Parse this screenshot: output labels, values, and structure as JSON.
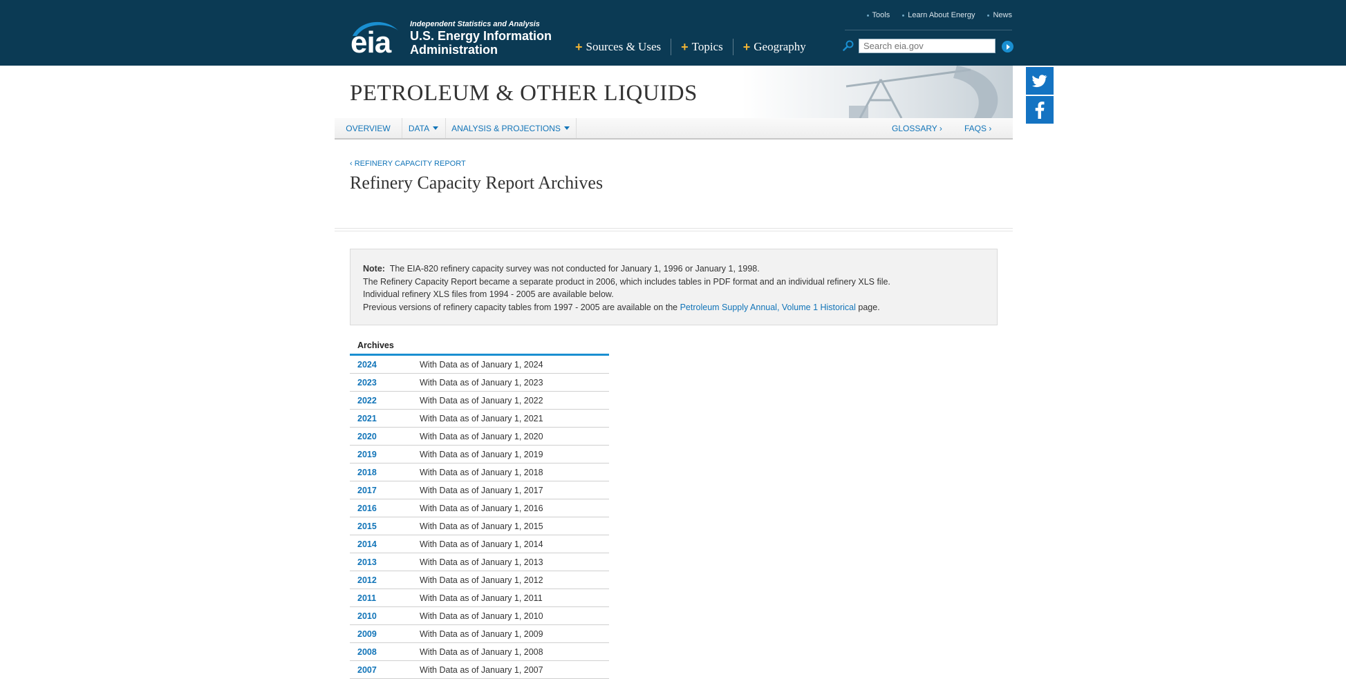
{
  "header": {
    "logo_text": "eia",
    "tagline": "Independent Statistics and Analysis",
    "agency_name": "U.S. Energy Information Administration",
    "main_nav": [
      {
        "label": "Sources & Uses"
      },
      {
        "label": "Topics"
      },
      {
        "label": "Geography"
      }
    ],
    "util_nav": [
      {
        "label": "Tools"
      },
      {
        "label": "Learn About Energy"
      },
      {
        "label": "News"
      }
    ],
    "search": {
      "placeholder": "Search eia.gov",
      "value": ""
    },
    "colors": {
      "bar": "#0b3a54",
      "accent": "#f1b434",
      "link": "#1174b8"
    }
  },
  "social": {
    "icons": [
      "twitter-icon",
      "facebook-icon"
    ]
  },
  "banner": {
    "title": "PETROLEUM & OTHER LIQUIDS"
  },
  "subnav": {
    "items": [
      {
        "label": "OVERVIEW"
      },
      {
        "label": "DATA"
      },
      {
        "label": "ANALYSIS & PROJECTIONS"
      }
    ],
    "right": [
      {
        "label": "GLOSSARY ›"
      },
      {
        "label": "FAQS ›"
      }
    ]
  },
  "content": {
    "breadcrumb": "‹ REFINERY CAPACITY REPORT",
    "title": "Refinery Capacity Report Archives",
    "note": {
      "label": "Note:",
      "line1": "The EIA-820 refinery capacity survey was not conducted for January 1, 1996 or January 1, 1998.",
      "line2": "The Refinery Capacity Report became a separate product in 2006, which includes tables in PDF format and an individual refinery XLS file.",
      "line3": "Individual refinery XLS files from 1994 - 2005 are available below.",
      "line4_prefix": "Previous versions of refinery capacity tables from 1997 - 2005 are available on the",
      "line4_link": "Petroleum Supply Annual, Volume 1 Historical",
      "line4_suffix": "page."
    },
    "archives": {
      "heading": "Archives",
      "rows": [
        {
          "year": "2024",
          "desc": "With Data as of January 1, 2024"
        },
        {
          "year": "2023",
          "desc": "With Data as of January 1, 2023"
        },
        {
          "year": "2022",
          "desc": "With Data as of January 1, 2022"
        },
        {
          "year": "2021",
          "desc": "With Data as of January 1, 2021"
        },
        {
          "year": "2020",
          "desc": "With Data as of January 1, 2020"
        },
        {
          "year": "2019",
          "desc": "With Data as of January 1, 2019"
        },
        {
          "year": "2018",
          "desc": "With Data as of January 1, 2018"
        },
        {
          "year": "2017",
          "desc": "With Data as of January 1, 2017"
        },
        {
          "year": "2016",
          "desc": "With Data as of January 1, 2016"
        },
        {
          "year": "2015",
          "desc": "With Data as of January 1, 2015"
        },
        {
          "year": "2014",
          "desc": "With Data as of January 1, 2014"
        },
        {
          "year": "2013",
          "desc": "With Data as of January 1, 2013"
        },
        {
          "year": "2012",
          "desc": "With Data as of January 1, 2012"
        },
        {
          "year": "2011",
          "desc": "With Data as of January 1, 2011"
        },
        {
          "year": "2010",
          "desc": "With Data as of January 1, 2010"
        },
        {
          "year": "2009",
          "desc": "With Data as of January 1, 2009"
        },
        {
          "year": "2008",
          "desc": "With Data as of January 1, 2008"
        },
        {
          "year": "2007",
          "desc": "With Data as of January 1, 2007"
        }
      ]
    }
  }
}
